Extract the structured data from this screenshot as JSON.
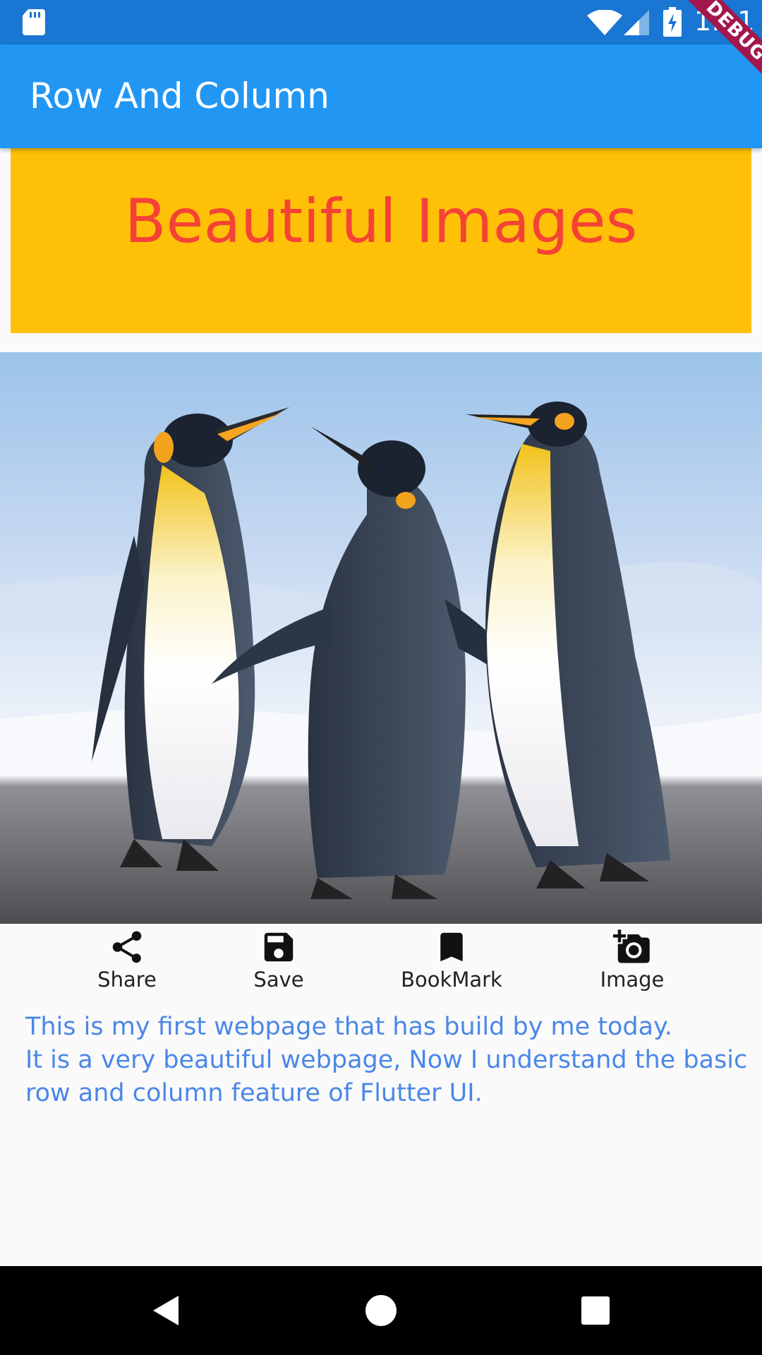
{
  "status_bar": {
    "time": "1:21",
    "icons": [
      "sd-card-icon",
      "wifi-icon",
      "cell-signal-icon",
      "battery-charging-icon"
    ]
  },
  "debug_banner": "DEBUG",
  "app_bar": {
    "title": "Row And Column",
    "color": "#2196f3"
  },
  "heading": {
    "text": "Beautiful Images",
    "background": "#ffc107",
    "color": "#f44336"
  },
  "actions": [
    {
      "label": "Share",
      "icon": "share-icon"
    },
    {
      "label": "Save",
      "icon": "save-icon"
    },
    {
      "label": "BookMark",
      "icon": "bookmark-icon"
    },
    {
      "label": "Image",
      "icon": "add-a-photo-icon"
    }
  ],
  "description": "This is my first webpage that has build by me today.\n It is a very beautiful webpage, Now I understand the basic\n row and column feature of Flutter UI.",
  "nav_bar": {
    "buttons": [
      "back-icon",
      "home-icon",
      "recents-icon"
    ]
  }
}
